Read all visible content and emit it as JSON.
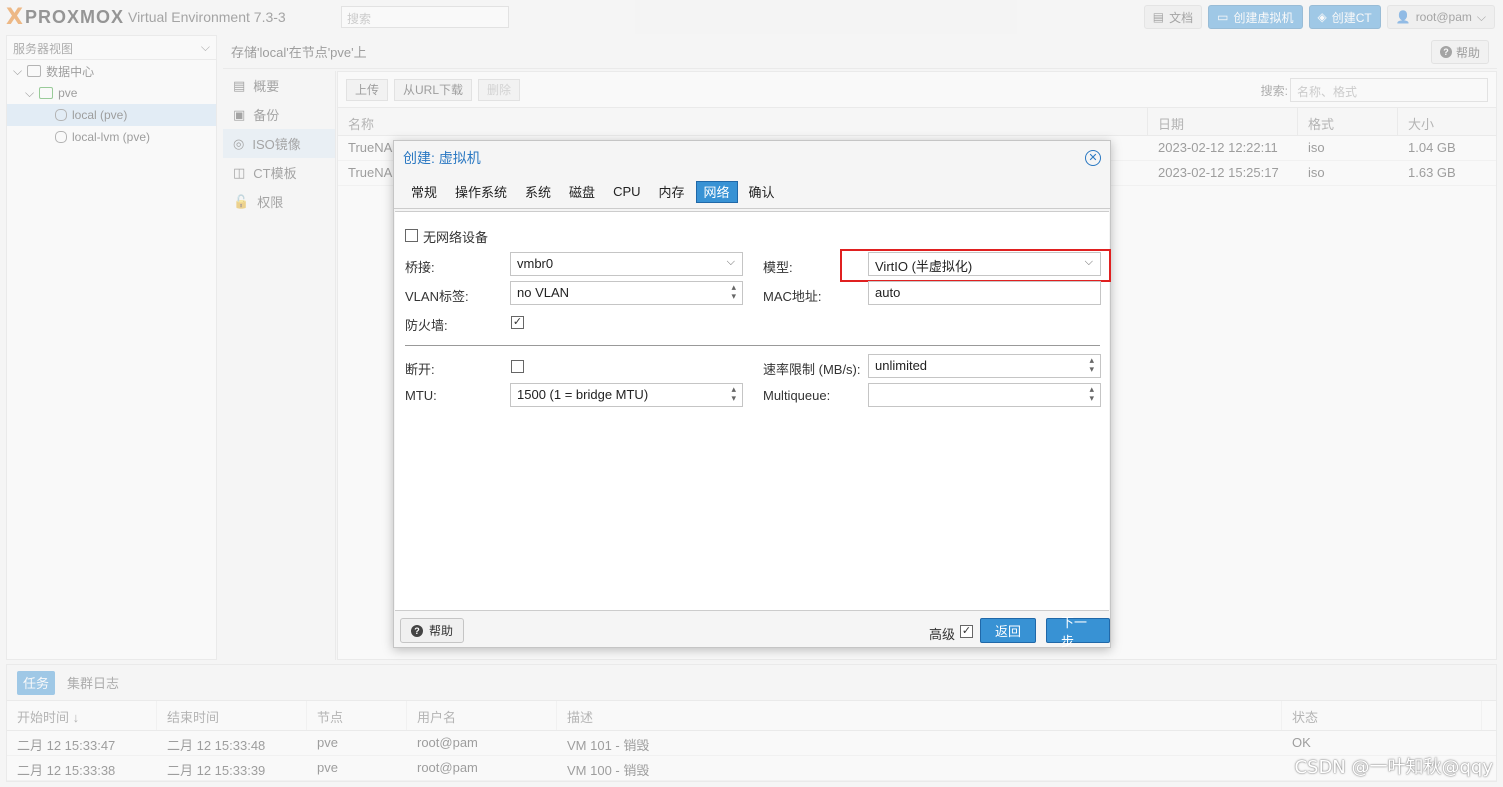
{
  "topbar": {
    "logo_x": "X",
    "logo_text": "PROXMOX",
    "product": "Virtual Environment 7.3-3",
    "search_placeholder": "搜索",
    "docs_label": "文档",
    "create_vm_label": "创建虚拟机",
    "create_ct_label": "创建CT",
    "user_label": "root@pam"
  },
  "left": {
    "view_label": "服务器视图",
    "tree": [
      {
        "label": "数据中心"
      },
      {
        "label": "pve"
      },
      {
        "label": "local (pve)"
      },
      {
        "label": "local-lvm (pve)"
      }
    ]
  },
  "storage": {
    "header": "存储'local'在节点'pve'上",
    "help_label": "帮助",
    "subnav": [
      {
        "label": "概要"
      },
      {
        "label": "备份"
      },
      {
        "label": "ISO镜像"
      },
      {
        "label": "CT模板"
      },
      {
        "label": "权限"
      }
    ],
    "toolbar": {
      "upload": "上传",
      "download_url": "从URL下载",
      "delete": "删除",
      "search_label": "搜索:",
      "search_placeholder": "名称、格式"
    },
    "columns": [
      "名称",
      "日期",
      "格式",
      "大小"
    ],
    "rows": [
      {
        "name": "TrueNA",
        "date": "2023-02-12 12:22:11",
        "format": "iso",
        "size": "1.04 GB"
      },
      {
        "name": "TrueNA",
        "date": "2023-02-12 15:25:17",
        "format": "iso",
        "size": "1.63 GB"
      }
    ]
  },
  "tasks": {
    "tab_tasks": "任务",
    "tab_cluster_log": "集群日志",
    "columns": [
      "开始时间 ↓",
      "结束时间",
      "节点",
      "用户名",
      "描述",
      "状态"
    ],
    "rows": [
      {
        "start": "二月 12 15:33:47",
        "end": "二月 12 15:33:48",
        "node": "pve",
        "user": "root@pam",
        "desc": "VM 101 - 销毁",
        "status": "OK"
      },
      {
        "start": "二月 12 15:33:38",
        "end": "二月 12 15:33:39",
        "node": "pve",
        "user": "root@pam",
        "desc": "VM 100 - 销毁",
        "status": ""
      }
    ]
  },
  "dialog": {
    "title": "创建: 虚拟机",
    "tabs": [
      "常规",
      "操作系统",
      "系统",
      "磁盘",
      "CPU",
      "内存",
      "网络",
      "确认"
    ],
    "active_tab": "网络",
    "no_network_label": "无网络设备",
    "bridge_label": "桥接:",
    "bridge_value": "vmbr0",
    "model_label": "模型:",
    "model_value": "VirtIO (半虚拟化)",
    "vlan_label": "VLAN标签:",
    "vlan_value": "no VLAN",
    "mac_label": "MAC地址:",
    "mac_value": "auto",
    "firewall_label": "防火墙:",
    "firewall_checked": true,
    "disconnect_label": "断开:",
    "rate_label": "速率限制 (MB/s):",
    "rate_value": "unlimited",
    "mtu_label": "MTU:",
    "mtu_value": "1500 (1 = bridge MTU)",
    "multiqueue_label": "Multiqueue:",
    "multiqueue_value": "",
    "help_label": "帮助",
    "advanced_label": "高级",
    "advanced_checked": true,
    "back_label": "返回",
    "next_label": "下一步"
  },
  "watermark": "CSDN @一叶知秋@qqy"
}
